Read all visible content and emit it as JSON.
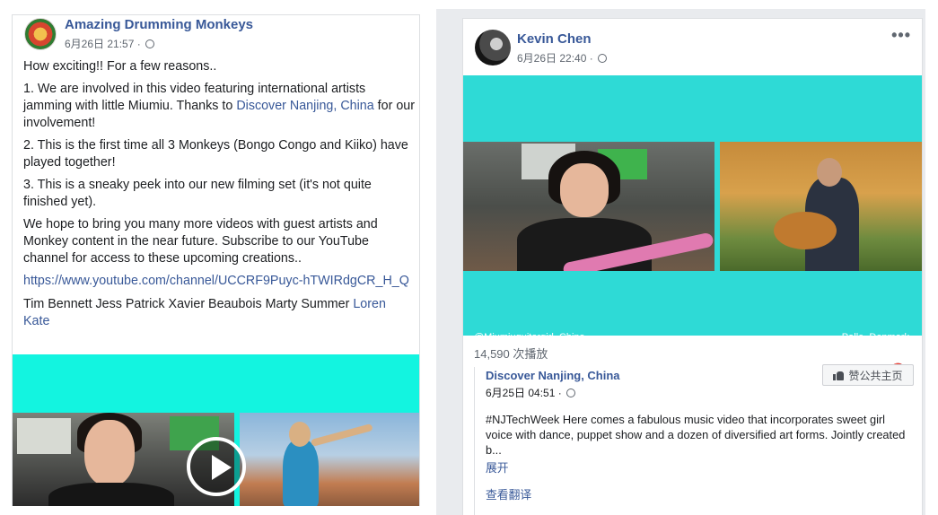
{
  "left_post": {
    "page_name": "Amazing Drumming Monkeys",
    "timestamp": "6月26日 21:57",
    "meta_sep": "·",
    "p1": "How exciting!! For a few reasons..",
    "p2_a": "1. We are involved in this video featuring international artists jamming with little Miumiu. Thanks to ",
    "p2_link": "Discover Nanjing, China",
    "p2_b": " for our involvement!",
    "p3": "2. This is the first time all 3 Monkeys (Bongo Congo and Kiiko) have played together!",
    "p4": "3. This is a sneaky peek into our new filming set (it's not quite finished yet).",
    "p5": "We hope to bring you many more videos with guest artists and Monkey content in the near future. Subscribe to our YouTube channel for access to these upcoming creations..",
    "url": "https://www.youtube.com/channel/UCCRF9Puyc-hTWIRdgCR_H_Q",
    "tags_plain": "Tim Bennett Jess Patrick Xavier Beaubois Marty Summer ",
    "tags_link": "Loren Kate"
  },
  "right_post": {
    "author": "Kevin Chen",
    "timestamp": "6月26日 22:40",
    "meta_sep": "·",
    "more": "•••",
    "caption_left": "@Miumiuguitargirl, China",
    "caption_right": "Palle, Denmark",
    "mute": "🔇",
    "views": "14,590 次播放",
    "shared": {
      "page_name": "Discover Nanjing, China",
      "timestamp": "6月25日 04:51",
      "meta_sep": "·",
      "like_label": "赞公共主页",
      "text": "#NJTechWeek Here comes a fabulous music video that incorporates sweet girl voice with dance, puppet show and a dozen of diversified art forms. Jointly created b...",
      "see_more": "展开",
      "translate": "查看翻译"
    }
  }
}
